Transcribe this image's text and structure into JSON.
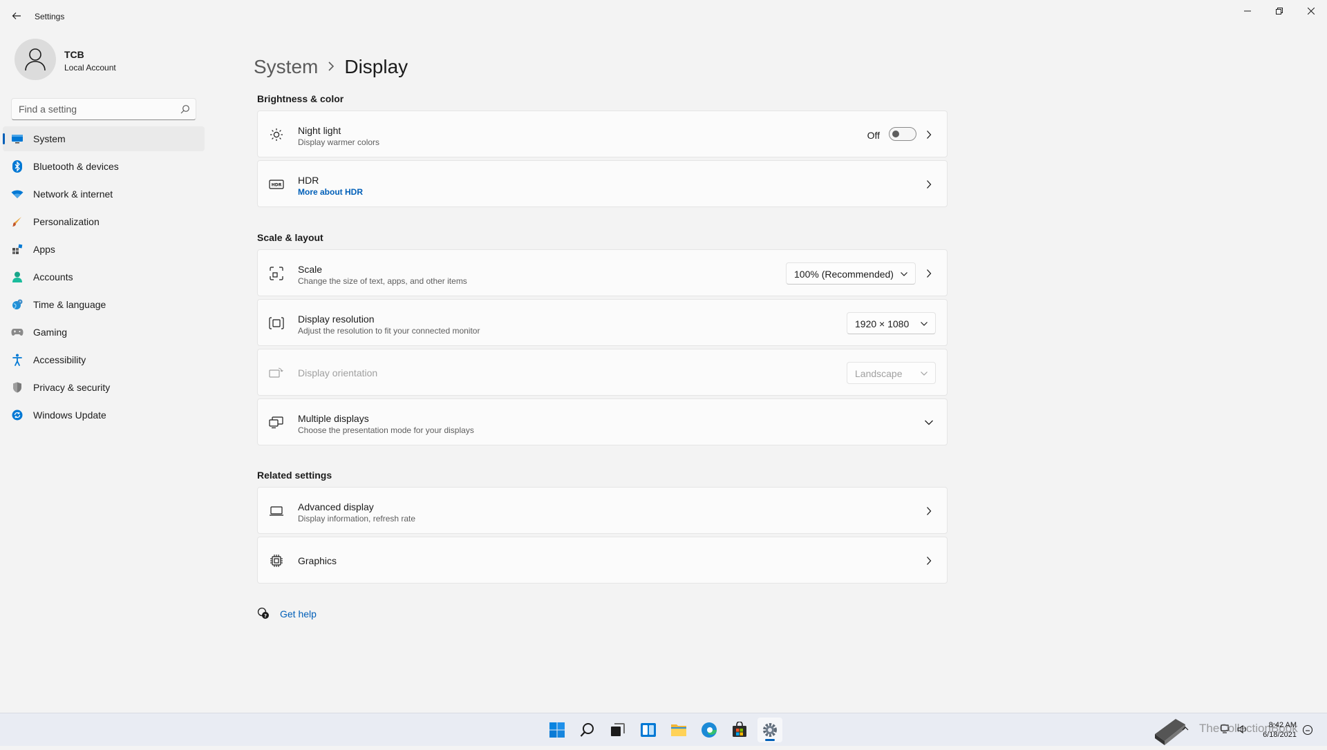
{
  "window": {
    "title": "Settings"
  },
  "profile": {
    "name": "TCB",
    "account_type": "Local Account"
  },
  "search": {
    "placeholder": "Find a setting"
  },
  "nav": {
    "items": [
      {
        "label": "System",
        "icon": "monitor-icon",
        "active": true
      },
      {
        "label": "Bluetooth & devices",
        "icon": "bluetooth-icon"
      },
      {
        "label": "Network & internet",
        "icon": "wifi-icon"
      },
      {
        "label": "Personalization",
        "icon": "brush-icon"
      },
      {
        "label": "Apps",
        "icon": "apps-icon"
      },
      {
        "label": "Accounts",
        "icon": "person-icon"
      },
      {
        "label": "Time & language",
        "icon": "globe-clock-icon"
      },
      {
        "label": "Gaming",
        "icon": "gamepad-icon"
      },
      {
        "label": "Accessibility",
        "icon": "accessibility-icon"
      },
      {
        "label": "Privacy & security",
        "icon": "shield-icon"
      },
      {
        "label": "Windows Update",
        "icon": "update-icon"
      }
    ]
  },
  "breadcrumb": {
    "parent": "System",
    "separator": "›",
    "current": "Display"
  },
  "sections": {
    "brightness": "Brightness & color",
    "scale_layout": "Scale & layout",
    "related": "Related settings"
  },
  "cards": {
    "night_light": {
      "title": "Night light",
      "subtitle": "Display warmer colors",
      "toggle_state": "Off"
    },
    "hdr": {
      "title": "HDR",
      "link": "More about HDR"
    },
    "scale": {
      "title": "Scale",
      "subtitle": "Change the size of text, apps, and other items",
      "value": "100% (Recommended)"
    },
    "resolution": {
      "title": "Display resolution",
      "subtitle": "Adjust the resolution to fit your connected monitor",
      "value": "1920 × 1080"
    },
    "orientation": {
      "title": "Display orientation",
      "value": "Landscape"
    },
    "multiple": {
      "title": "Multiple displays",
      "subtitle": "Choose the presentation mode for your displays"
    },
    "advanced": {
      "title": "Advanced display",
      "subtitle": "Display information, refresh rate"
    },
    "graphics": {
      "title": "Graphics"
    }
  },
  "help": {
    "label": "Get help"
  },
  "taskbar": {
    "clock_time": "8:42 AM",
    "clock_date": "6/18/2021",
    "watermark": "TheCollectionBook"
  },
  "colors": {
    "accent": "#005fb8",
    "background": "#f3f3f3",
    "card": "#fbfbfb"
  }
}
